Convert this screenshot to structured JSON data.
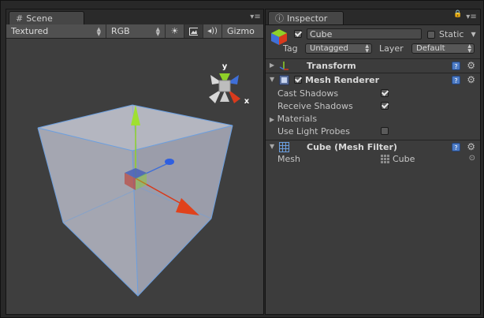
{
  "scene": {
    "tab_label": "Scene",
    "toolbar": {
      "render_mode": "Textured",
      "color_mode": "RGB",
      "gizmos_label": "Gizmo"
    },
    "orientation_gizmo": {
      "y_label": "y",
      "x_label": "x"
    }
  },
  "inspector": {
    "tab_label": "Inspector",
    "object": {
      "active": true,
      "name": "Cube",
      "static_label": "Static",
      "static_checked": false,
      "tag_label": "Tag",
      "tag_value": "Untagged",
      "layer_label": "Layer",
      "layer_value": "Default"
    },
    "components": {
      "transform": {
        "title": "Transform"
      },
      "mesh_renderer": {
        "title": "Mesh Renderer",
        "enabled": true,
        "cast_shadows_label": "Cast Shadows",
        "cast_shadows": true,
        "receive_shadows_label": "Receive Shadows",
        "receive_shadows": true,
        "materials_label": "Materials",
        "light_probes_label": "Use Light Probes",
        "light_probes": false
      },
      "mesh_filter": {
        "title": "Cube (Mesh Filter)",
        "mesh_label": "Mesh",
        "mesh_value": "Cube"
      }
    },
    "help_glyph": "?"
  },
  "colors": {
    "x_axis": "#d83a1c",
    "y_axis": "#8fd128",
    "z_axis": "#3f6fd8",
    "selection_wire": "#6b9fe0",
    "cube_face": "#a9abb6"
  }
}
